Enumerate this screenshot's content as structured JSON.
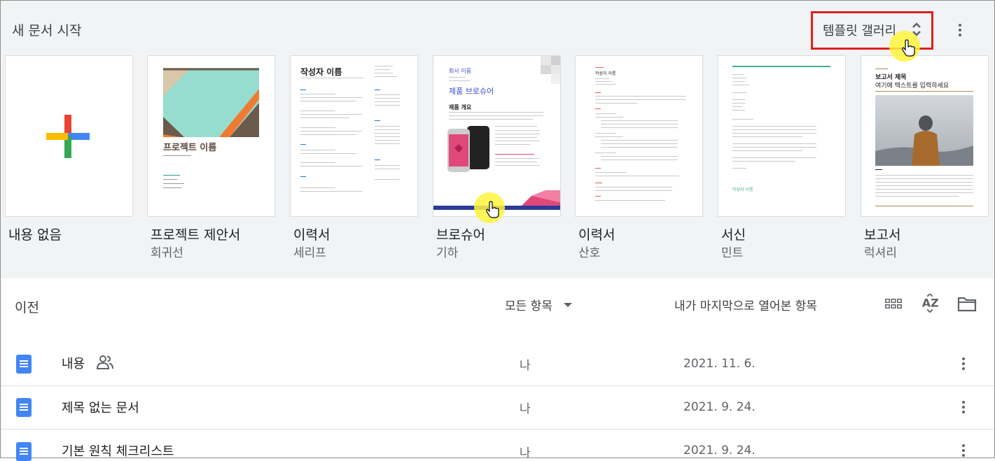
{
  "header": {
    "title": "새 문서 시작",
    "gallery_label": "템플릿 갤러리"
  },
  "templates": [
    {
      "name": "내용 없음",
      "sub": ""
    },
    {
      "name": "프로젝트 제안서",
      "sub": "회귀선",
      "thumb_title": "프로젝트 이름"
    },
    {
      "name": "이력서",
      "sub": "세리프",
      "thumb_title": "작성자 이름"
    },
    {
      "name": "브로슈어",
      "sub": "기하",
      "thumb_company": "회사 이름",
      "thumb_title": "제품 브로슈어",
      "thumb_section": "제품 개요"
    },
    {
      "name": "이력서",
      "sub": "산호",
      "thumb_title": "작성자 이름"
    },
    {
      "name": "서신",
      "sub": "민트",
      "thumb_sign": "작성자 이름"
    },
    {
      "name": "보고서",
      "sub": "럭셔리",
      "thumb_title": "보고서 제목",
      "thumb_subtitle": "여기에 텍스트를 입력하세요"
    }
  ],
  "recent": {
    "title": "이전",
    "filter_label": "모든 항목",
    "sort_label": "내가 마지막으로 열어본 항목",
    "rows": [
      {
        "name": "내용",
        "shared": true,
        "owner": "나",
        "date": "2021. 11. 6."
      },
      {
        "name": "제목 없는 문서",
        "shared": false,
        "owner": "나",
        "date": "2021. 9. 24."
      },
      {
        "name": "기본 원칙 체크리스트",
        "shared": false,
        "owner": "나",
        "date": "2021. 9. 24."
      }
    ]
  },
  "icons": {
    "gallery": "unfold-icon",
    "more": "more-vert-icon",
    "grid": "grid-view-icon",
    "sort": "sort-az-icon",
    "folder": "folder-icon",
    "doc": "docs-file-icon",
    "shared": "people-icon"
  },
  "colors": {
    "highlight_box": "#e0201c",
    "cursor_highlight": "#fff53c",
    "doc_blue": "#4285f4"
  }
}
